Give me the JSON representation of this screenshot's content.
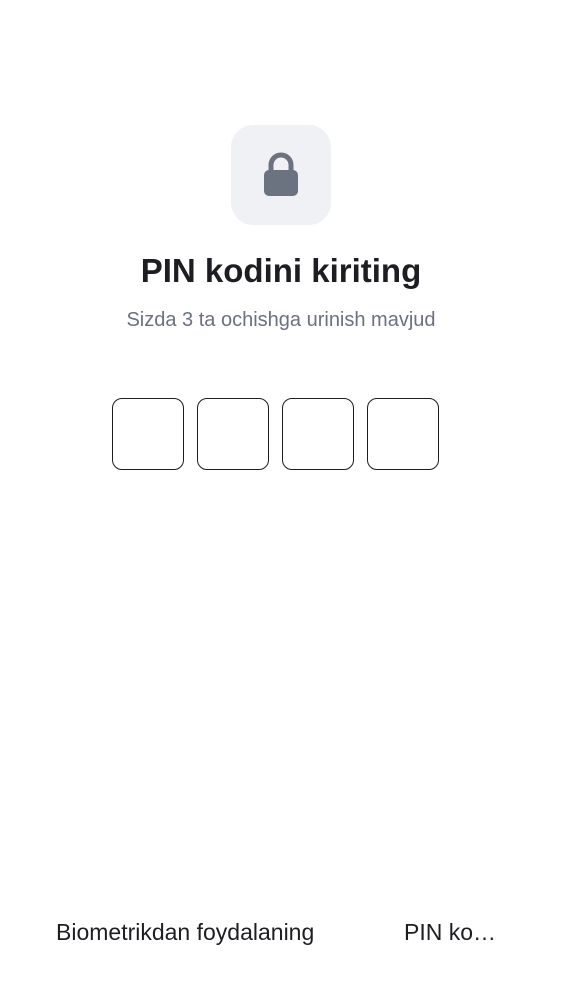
{
  "lock": {
    "icon": "lock-icon"
  },
  "header": {
    "title": "PIN kodini kiriting",
    "subtitle": "Sizda 3 ta ochishga urinish mavjud"
  },
  "pin": {
    "length": 4,
    "digits": [
      "",
      "",
      "",
      ""
    ]
  },
  "actions": {
    "biometric_label": "Biometrikdan foydalaning",
    "pin_label": "PIN ko…"
  },
  "colors": {
    "background": "#ffffff",
    "text_primary": "#1d1d22",
    "text_secondary": "#6b7180",
    "tile_bg": "#f0f1f5",
    "icon": "#6b7280"
  }
}
